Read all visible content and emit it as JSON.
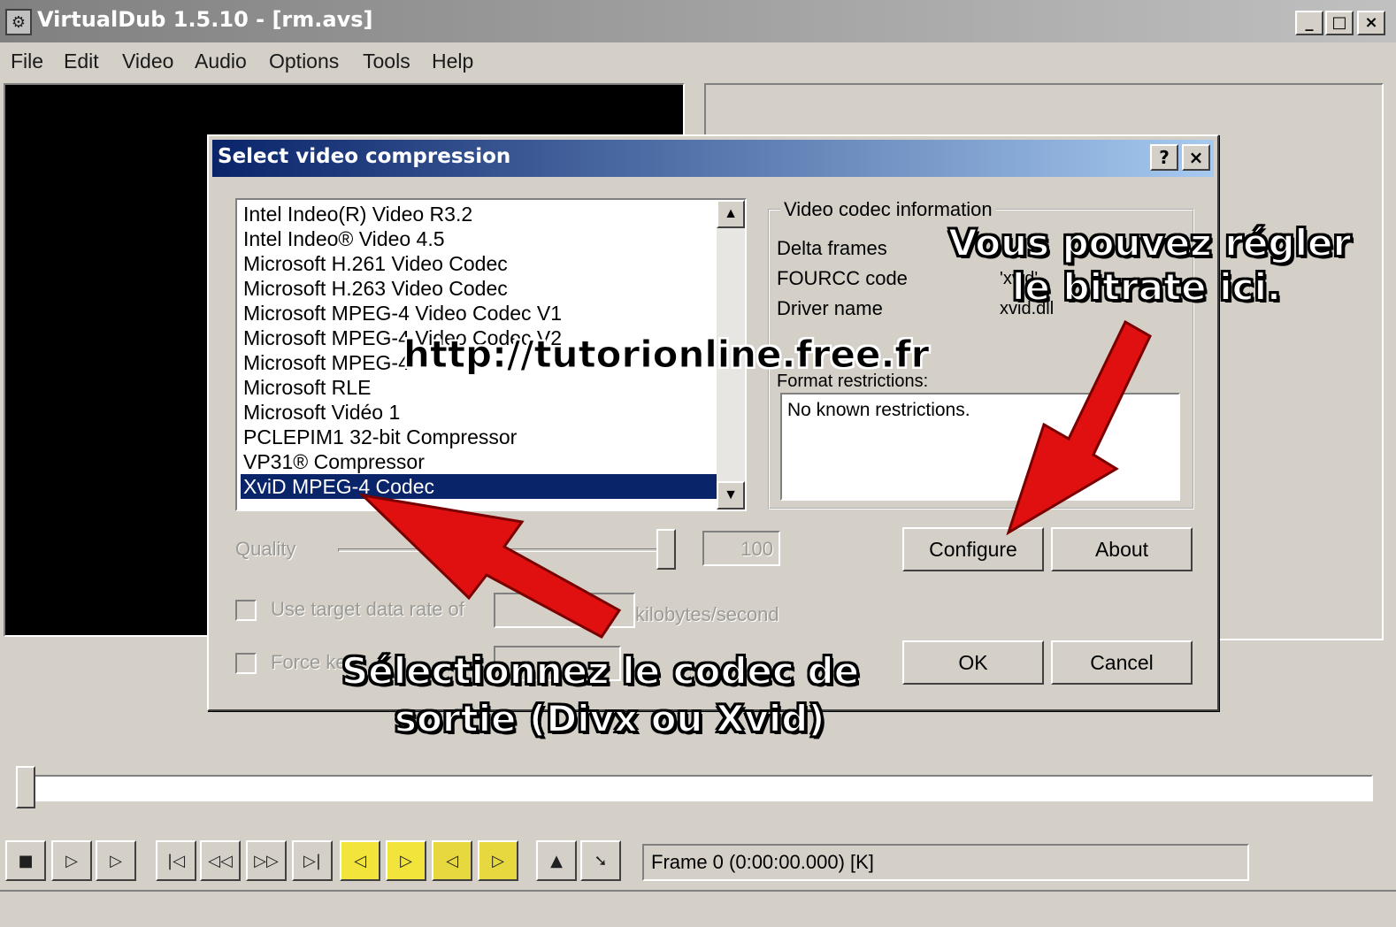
{
  "window": {
    "title": "VirtualDub 1.5.10 - [rm.avs]",
    "controls": {
      "minimize": "_",
      "maximize": "□",
      "close": "×"
    }
  },
  "menu": [
    "File",
    "Edit",
    "Video",
    "Audio",
    "Options",
    "Tools",
    "Help"
  ],
  "dialog": {
    "title": "Select video compression",
    "help_label": "?",
    "close_label": "×",
    "codecs": [
      "Intel Indeo(R) Video R3.2",
      "Intel Indeo® Video 4.5",
      "Microsoft H.261 Video Codec",
      "Microsoft H.263 Video Codec",
      "Microsoft MPEG-4 Video Codec V1",
      "Microsoft MPEG-4 Video Codec V2",
      "Microsoft MPEG-4",
      "Microsoft RLE",
      "Microsoft Vidéo 1",
      "PCLEPIM1 32-bit Compressor",
      "VP31® Compressor",
      "XviD MPEG-4 Codec"
    ],
    "selected_codec": "XviD MPEG-4 Codec",
    "info": {
      "legend": "Video codec information",
      "delta_frames_label": "Delta frames",
      "fourcc_label": "FOURCC code",
      "fourcc_value": "'xvid'",
      "driver_label": "Driver name",
      "driver_value": "xvid.dll",
      "restrictions_label": "Format restrictions:",
      "restrictions_text": "No known restrictions."
    },
    "quality_label": "Quality",
    "quality_value": "100",
    "quality_level": 1.0,
    "datarate_label": "Use target data rate of",
    "datarate_unit": "kilobytes/second",
    "keyframe_label": "Force ke",
    "buttons": {
      "configure": "Configure",
      "about": "About",
      "ok": "OK",
      "cancel": "Cancel"
    }
  },
  "frame_display": "Frame 0 (0:00:00.000) [K]",
  "toolbar_icons": [
    "stop-icon",
    "play-input-icon",
    "play-output-icon",
    "go-start-icon",
    "prev-key-icon",
    "next-key-icon",
    "go-end-icon",
    "scene-back-icon",
    "scene-fwd-icon",
    "mark-in-icon",
    "mark-out-icon",
    "arrow-up-icon",
    "arrow-down-icon"
  ],
  "annotations": {
    "watermark": "http://tutorionline.free.fr",
    "bitrate_line1": "Vous pouvez régler",
    "bitrate_line2": "le bitrate ici.",
    "select_line1": "Sélectionnez le codec de",
    "select_line2": "sortie (Divx ou Xvid)",
    "arrow_color": "#e01010"
  }
}
